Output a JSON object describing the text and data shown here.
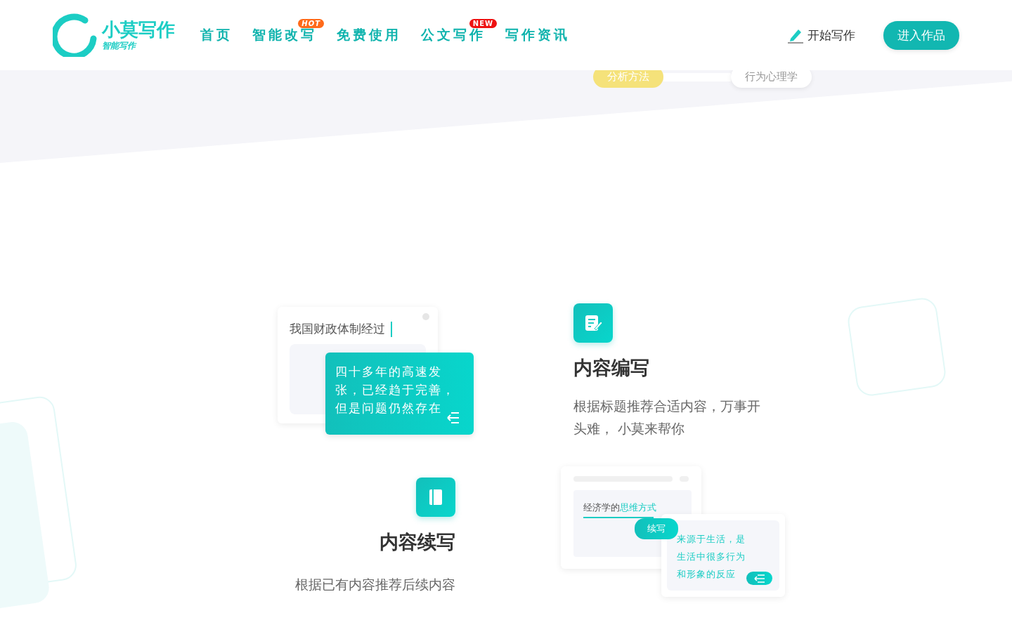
{
  "header": {
    "logo": {
      "name": "小莫写作",
      "tagline": "智能写作"
    },
    "nav": [
      {
        "label": "首页"
      },
      {
        "label": "智能改写",
        "badge": {
          "kind": "hot",
          "text": "HOT"
        }
      },
      {
        "label": "免费使用"
      },
      {
        "label": "公文写作",
        "badge": {
          "kind": "new",
          "text": "NEW"
        }
      },
      {
        "label": "写作资讯"
      }
    ],
    "start_writing": "开始写作",
    "enter_works": "进入作品"
  },
  "banner_tags": [
    "分析方法",
    "行为心理学"
  ],
  "features": [
    {
      "kind": "compose",
      "title": "内容编写",
      "description": "根据标题推荐合适内容，万事开头难， 小莫来帮你",
      "demo": {
        "input": "我国财政体制经过",
        "output": "四十多年的高速发张，已经趋于完善，但是问题仍然存在"
      }
    },
    {
      "kind": "continue",
      "title": "内容续写",
      "description": "根据已有内容推荐后续内容",
      "demo": {
        "input": "经济学的**思维方式**",
        "button": "续写",
        "output": "来源于生活，是生活中很多行为和形象的反应"
      }
    }
  ]
}
